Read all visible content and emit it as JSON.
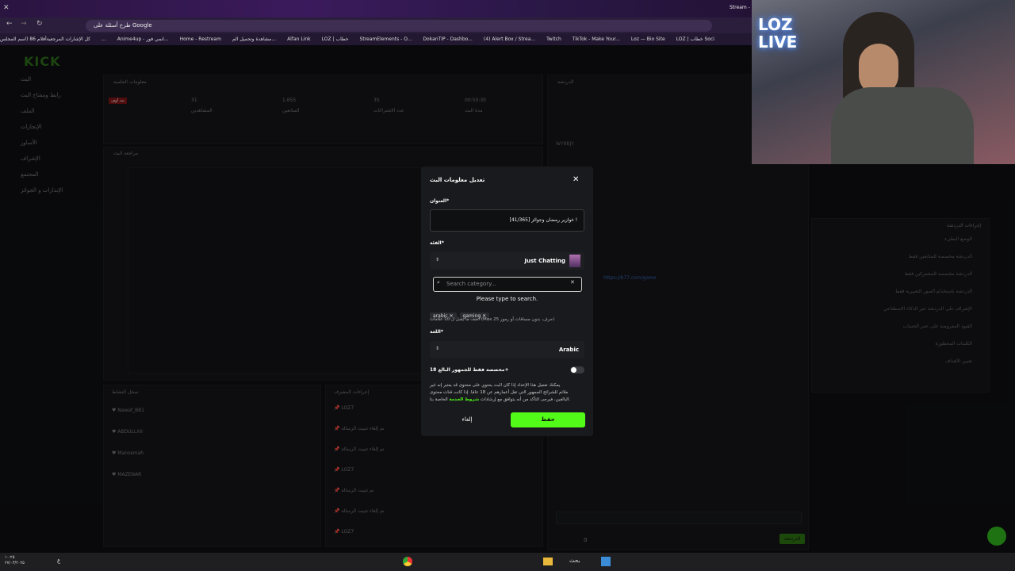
{
  "browser": {
    "tab_title": "Stream -",
    "search_placeholder": "طرح أسئلة على Google",
    "bookmarks": [
      "كل الإشارات المرجعية",
      "أفلام 86 (اسم المجلس...",
      "Anime4up - انمي فور...",
      "Home - Restream",
      "مشاهدة وتحميل الم...",
      "Alfan Link",
      "LOZ | خطاب",
      "StreamElements - O...",
      "DokanTIP - Dashbo...",
      "(4) Alert Box / Strea...",
      "Twitch",
      "TikTok - Make Your...",
      "Loz — Bio Site",
      "LOZ | خطاب Soci"
    ]
  },
  "site": {
    "logo": "KICK",
    "sidebar": [
      "البث",
      "رابط ومفتاح البث",
      "الملف",
      "الإنجازات",
      "الأساور",
      "الإشراف",
      "المجتمع",
      "الإنذارات و الجوائز"
    ],
    "stats_header": "معلومات الجلسة",
    "stats_live_badge": "بث أوف",
    "stats": [
      {
        "value": "31",
        "label": "المشاهدين"
      },
      {
        "value": "1,655",
        "label": "المتابعين"
      },
      {
        "value": "35",
        "label": "عدد الاشتراكات"
      },
      {
        "value": "00:50:30",
        "label": "مدة البث"
      }
    ],
    "preview_header": "مراجعة البث",
    "recent_header": "سجل النشاط",
    "recent_list": [
      "Nawaf_B81",
      "ABDULLXII",
      "Manosmah",
      "MAZENAR"
    ],
    "actions_header": "إجراءات المشرف",
    "actions_list": [
      "LOZ7",
      "تم إلغاء تثبيت الرسالة",
      "تم إلغاء تثبيت الرسالة",
      "LOZ7",
      "تم تثبيت الرسالة",
      "تم إلغاء تثبيت الرسالة",
      "LOZ7"
    ],
    "chat_header": "الدردشة",
    "chat_code": "WY8BJY",
    "chat_link": "https://b77.com/game",
    "mod_panel_header": "إجراءات الدردشة",
    "mod_panel_items": [
      "الوضع البطيء",
      "الدردشة مخصصة للمتابعين فقط",
      "الدردشة مخصصة للمشتركين فقط",
      "الدردشة باستخدام الصور التعبيرية فقط",
      "الإشراف على الدردشة عبر الذكاء الاصطناعي",
      "القيود المفروضة على عمر الحساب",
      "الكلمات المحظورة",
      "تعيين الأهداف"
    ],
    "send_label": "الدردشة",
    "green_badge": "0"
  },
  "modal": {
    "title": "تعديل معلومات البث",
    "title_label": "العنوان*",
    "title_value": "[41/365] غوازير رمضان وجوائز !",
    "category_label": "الفئة*",
    "category_value": "Just Chatting",
    "search_placeholder": "Search category...",
    "search_hint": "Please type to search.",
    "tags": [
      "arabic",
      "gaming"
    ],
    "tags_hint": "أضف ما يصل ل 10 علامات (Max 25 حرف، بدون مسافات أو رموز)",
    "language_label": "اللغة*",
    "language_value": "Arabic",
    "mature_label": "مخصصة فقط للجمهور البالغ 18+",
    "mature_desc_1": "يمكنك تفعيل هذا الإعداد إذا كان البث يحتوي على محتوى قد يعتبر إنه غير",
    "mature_desc_2": "ملائم للشرائح الجمهور التي تقل أعمارهم عن 18 عامًا. إذا كانت قنات محتوى",
    "mature_desc_3": "البالغين، فيرجى التأكد من أنه يتوافق مع إرشادات",
    "mature_link": "شروط الخدمة",
    "mature_desc_4": "الخاصة بنا.",
    "save": "حفظ",
    "cancel": "إلغاء"
  },
  "webcam": {
    "sign_text": "LOZ LIVE"
  },
  "taskbar": {
    "search": "بحث",
    "time": "۱۰:۲۵",
    "date": "۲۷/۰۳/۲۰۲۵",
    "lang": "ع"
  }
}
